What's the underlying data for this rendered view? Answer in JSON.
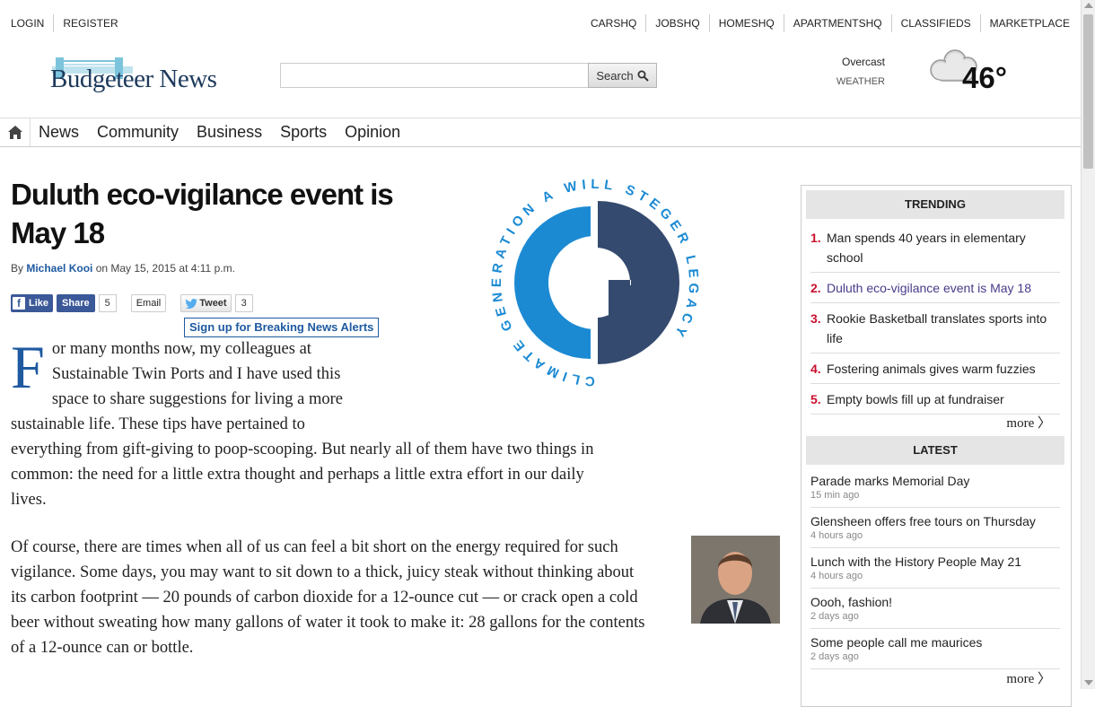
{
  "top_bar": {
    "left": [
      "LOGIN",
      "REGISTER"
    ],
    "right": [
      "CARSHQ",
      "JOBSHQ",
      "HOMESHQ",
      "APARTMENTSHQ",
      "CLASSIFIEDS",
      "MARKETPLACE"
    ]
  },
  "header": {
    "logo_text": "Budgeteer News",
    "search_placeholder": "",
    "search_button": "Search",
    "weather": {
      "condition": "Overcast",
      "label": "WEATHER",
      "temp": "46°"
    }
  },
  "nav": {
    "home_icon": "home-icon",
    "items": [
      "News",
      "Community",
      "Business",
      "Sports",
      "Opinion"
    ]
  },
  "article": {
    "headline": "Duluth eco-vigilance event is May 18",
    "byline_prefix": "By ",
    "author": "Michael Kooi",
    "date": " on May 15, 2015 at 4:11 p.m.",
    "share": {
      "like": "Like",
      "share": "Share",
      "fb_count": "5",
      "email": "Email",
      "tweet": "Tweet",
      "tweet_count": "3",
      "alerts": "Sign up for Breaking News Alerts"
    },
    "logo_ring_text": "CLIMATE GENERATION A WILL STEGER LEGACY",
    "dropcap": "F",
    "paragraph1": "or many months now, my colleagues at Sustainable Twin Ports and I have used this space to share suggestions for living a more sustainable life. These tips have pertained to everything from gift-giving to poop-scooping. But nearly all of them have two things in common: the need for a little extra thought and perhaps a little extra effort in our daily lives.",
    "paragraph2": "Of course, there are times when all of us can feel a bit short on the energy required for such vigilance. Some days, you may want to sit down to a thick, juicy steak without thinking about its carbon footprint — 20 pounds of carbon dioxide for a 12-ounce cut — or crack open a cold beer without sweating how many gallons of water it took to make it: 28 gallons for the contents of a 12-ounce can or bottle."
  },
  "sidebar": {
    "trending_title": "TRENDING",
    "trending": [
      {
        "num": "1.",
        "title": "Man spends 40 years in elementary school"
      },
      {
        "num": "2.",
        "title": "Duluth eco-vigilance event is May 18"
      },
      {
        "num": "3.",
        "title": "Rookie Basketball translates sports into life"
      },
      {
        "num": "4.",
        "title": "Fostering animals gives warm fuzzies"
      },
      {
        "num": "5.",
        "title": "Empty bowls fill up at fundraiser"
      }
    ],
    "more": "more 〉",
    "latest_title": "LATEST",
    "latest": [
      {
        "title": "Parade marks Memorial Day",
        "ago": "15 min ago"
      },
      {
        "title": "Glensheen offers free tours on Thursday",
        "ago": "4 hours ago"
      },
      {
        "title": "Lunch with the History People May 21",
        "ago": "4 hours ago"
      },
      {
        "title": "Oooh, fashion!",
        "ago": "2 days ago"
      },
      {
        "title": "Some people call me maurices",
        "ago": "2 days ago"
      }
    ]
  },
  "colors": {
    "link_blue": "#1f5aa0",
    "trend_red": "#c8102e",
    "fb_blue": "#3b5998",
    "logo_light": "#1b8ad3",
    "logo_dark": "#344a6e"
  }
}
